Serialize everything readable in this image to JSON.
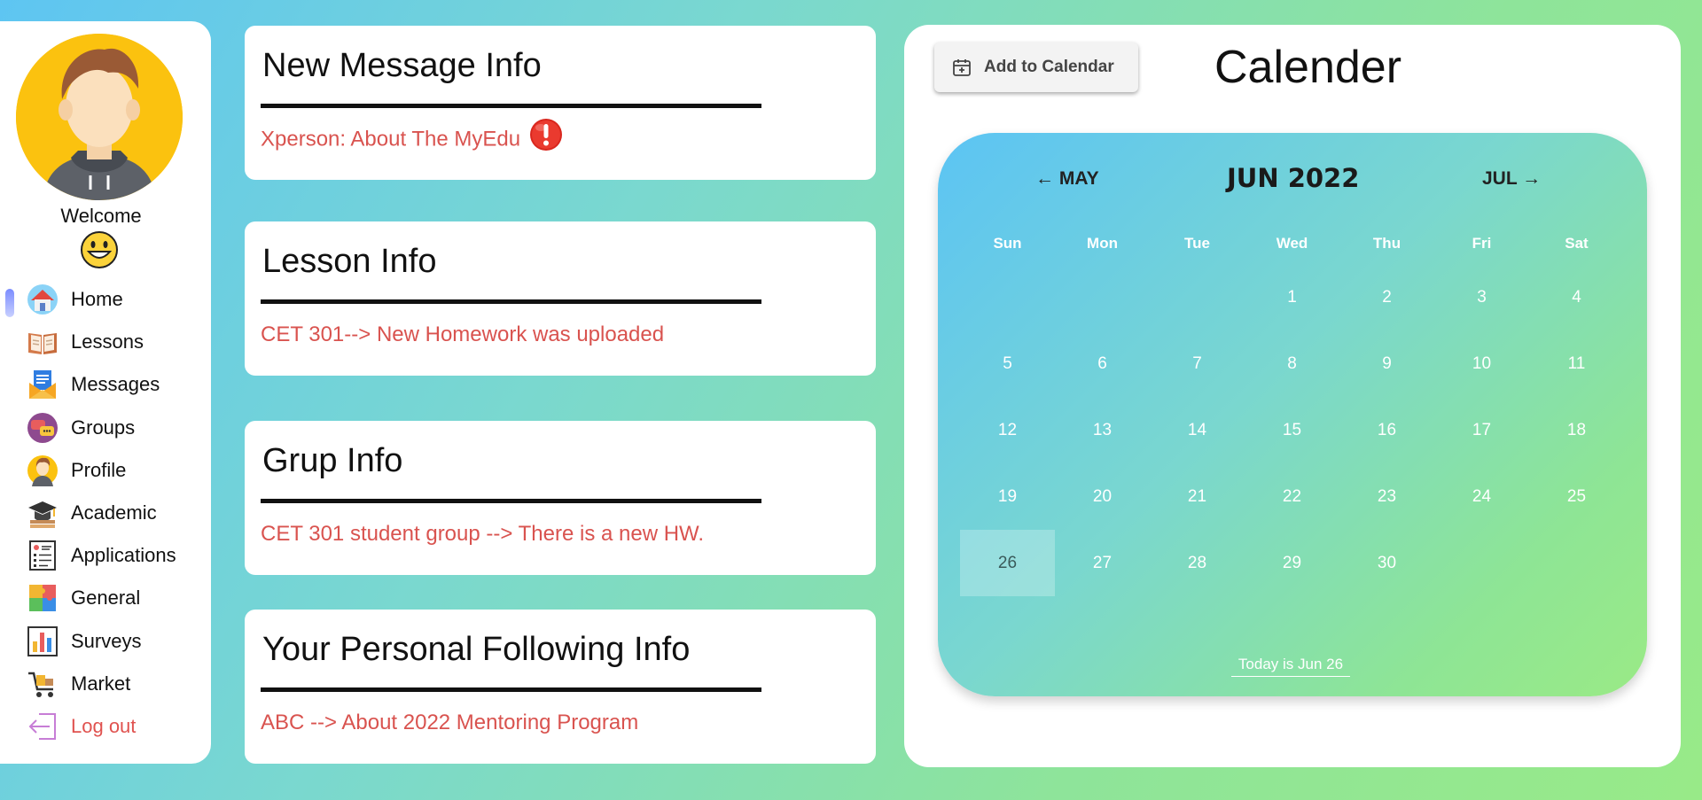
{
  "sidebar": {
    "welcome": "Welcome",
    "items": [
      {
        "name": "home",
        "label": "Home"
      },
      {
        "name": "lessons",
        "label": "Lessons"
      },
      {
        "name": "messages",
        "label": "Messages"
      },
      {
        "name": "groups",
        "label": "Groups"
      },
      {
        "name": "profile",
        "label": "Profile"
      },
      {
        "name": "academic",
        "label": "Academic"
      },
      {
        "name": "applications",
        "label": "Applications"
      },
      {
        "name": "general",
        "label": "General"
      },
      {
        "name": "surveys",
        "label": "Surveys"
      },
      {
        "name": "market",
        "label": "Market"
      },
      {
        "name": "logout",
        "label": "Log out"
      }
    ],
    "active_item": "Home"
  },
  "cards": [
    {
      "title": "New Message Info",
      "message": "Xperson: About The MyEdu",
      "alert": true
    },
    {
      "title": "Lesson Info",
      "message": "CET 301--> New Homework was uploaded"
    },
    {
      "title": "Grup Info",
      "message": "CET 301 student group --> There is a new HW."
    },
    {
      "title": "Your Personal Following Info",
      "message": "ABC --> About 2022 Mentoring Program"
    }
  ],
  "calendar_panel": {
    "add_button_label": "Add to Calendar",
    "title": "Calender",
    "prev_month": "← MAY",
    "current_month": "JUN 2022",
    "next_month": "JUL →",
    "weekdays": [
      "Sun",
      "Mon",
      "Tue",
      "Wed",
      "Thu",
      "Fri",
      "Sat"
    ],
    "first_weekday_index": 3,
    "days_in_month": 30,
    "today": 26,
    "today_label": "Today is Jun 26"
  },
  "colors": {
    "accent_red": "#d9534f",
    "avatar_bg": "#fbc20f",
    "logout_red": "#e0524f"
  }
}
